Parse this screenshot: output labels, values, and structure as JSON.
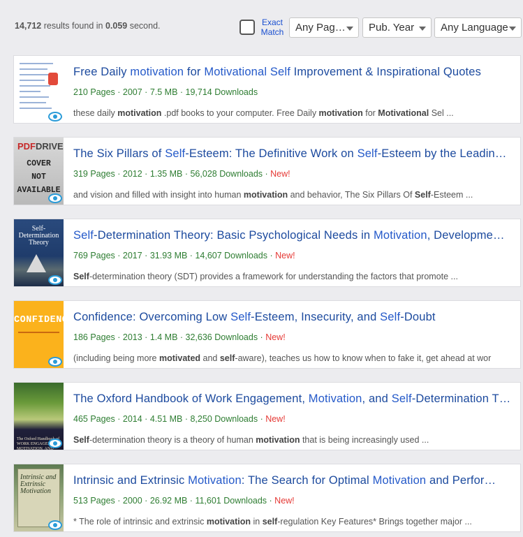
{
  "header": {
    "results_count": "14,712",
    "results_mid": " results found in ",
    "results_time": "0.059",
    "results_suffix": " second.",
    "exact_match_label": "Exact Match",
    "filters": {
      "pages": "Any Pag…",
      "year": "Pub. Year",
      "language": "Any Language"
    }
  },
  "results": [
    {
      "title": "Free Daily motivation for Motivational Self Improvement & Inspirational Quotes",
      "pages": "210 Pages",
      "year": "2007",
      "size": "7.5 MB",
      "downloads": "19,714 Downloads",
      "new": "",
      "snippet": "these daily motivation .pdf books to your computer. Free Daily motivation for Motivational Sel  ..."
    },
    {
      "title": "The Six Pillars of Self-Esteem: The Definitive Work on Self-Esteem by the Leadin…",
      "pages": "319 Pages",
      "year": "2012",
      "size": "1.35 MB",
      "downloads": "56,028 Downloads",
      "new": "New!",
      "snippet": "and vision and filled with insight into human motivation and behavior, The Six Pillars Of Self-Esteem  ...",
      "cover_brand_a": "PDF",
      "cover_brand_b": "DRIVE",
      "cover_line1": "COVER",
      "cover_line2": "NOT",
      "cover_line3": "AVAILABLE"
    },
    {
      "title": "Self-Determination Theory: Basic Psychological Needs in Motivation, Developme…",
      "pages": "769 Pages",
      "year": "2017",
      "size": "31.93 MB",
      "downloads": "14,607 Downloads",
      "new": "New!",
      "snippet": "Self-determination theory (SDT) provides a framework for understanding the factors that promote  ...",
      "cover_title": "Self-Determination Theory"
    },
    {
      "title": "Confidence: Overcoming Low Self-Esteem, Insecurity, and Self-Doubt",
      "pages": "186 Pages",
      "year": "2013",
      "size": "1.4 MB",
      "downloads": "32,636 Downloads",
      "new": "New!",
      "snippet": "(including being more motivated and self-aware), teaches us how to know when to fake it, get ahead at wor",
      "cover_title": "CONFIDENCE"
    },
    {
      "title": "The Oxford Handbook of Work Engagement, Motivation, and Self-Determination T…",
      "pages": "465 Pages",
      "year": "2014",
      "size": "4.51 MB",
      "downloads": "8,250 Downloads",
      "new": "New!",
      "snippet": "Self-determination theory is a theory of human motivation that is being increasingly used  ...",
      "cover_title": "The Oxford Handbook of WORK ENGAGEMENT, MOTIVATION, AND SELF-DETERMINATION"
    },
    {
      "title": "Intrinsic and Extrinsic Motivation: The Search for Optimal Motivation and Perfor…",
      "pages": "513 Pages",
      "year": "2000",
      "size": "26.92 MB",
      "downloads": "11,601 Downloads",
      "new": "New!",
      "snippet": "* The role of intrinsic and extrinsic motivation in self-regulation Key Features* Brings together major  ...",
      "cover_title": "Intrinsic and Extrinsic Motivation"
    }
  ],
  "colors": {
    "title": "#1c4a9e",
    "meta": "#2e7d32",
    "new_badge": "#e53935",
    "link": "#1a4fd0"
  }
}
